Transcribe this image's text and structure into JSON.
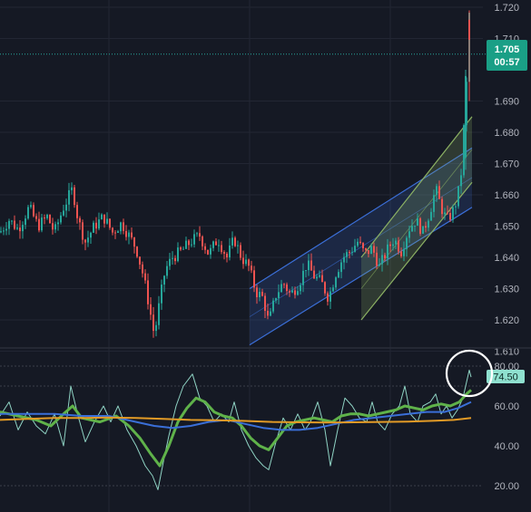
{
  "colors": {
    "background": "#151924",
    "grid": "#222633",
    "axis_text": "#b2b5be",
    "up_candle": "#26a69a",
    "down_candle": "#ef5350",
    "price_badge": "#1a9f86",
    "price_line": "#26a69a",
    "channel_blue": "#3b6fd8",
    "channel_blue_fill": "rgba(59,111,216,0.18)",
    "channel_green": "#8bb063",
    "channel_green_fill": "rgba(139,176,99,0.22)",
    "osc_fast": "#8fd3c4",
    "osc_green": "#5fb24a",
    "osc_blue": "#3a6fd8",
    "osc_orange": "#e39b26",
    "rsi_badge": "#8fe0cf",
    "highlight_circle": "#ffffff"
  },
  "price_axis": {
    "ticks": [
      "1.720",
      "1.710",
      "1.690",
      "1.680",
      "1.670",
      "1.660",
      "1.650",
      "1.640",
      "1.630",
      "1.620",
      "1.610"
    ]
  },
  "price_badge": {
    "price": "1.705",
    "countdown": "00:57"
  },
  "osc_axis": {
    "ticks": [
      "80.00",
      "60.00",
      "40.00",
      "20.00"
    ]
  },
  "osc_badge": {
    "value": "74.50"
  },
  "chart_data": [
    {
      "type": "candlestick",
      "title": "",
      "xlabel": "",
      "ylabel": "",
      "ylim": [
        1.605,
        1.722
      ],
      "last_price": 1.705,
      "price_path": [
        [
          0,
          1.648
        ],
        [
          10,
          1.652
        ],
        [
          20,
          1.649
        ],
        [
          32,
          1.656
        ],
        [
          42,
          1.65
        ],
        [
          52,
          1.653
        ],
        [
          60,
          1.648
        ],
        [
          70,
          1.656
        ],
        [
          80,
          1.662
        ],
        [
          86,
          1.652
        ],
        [
          94,
          1.645
        ],
        [
          104,
          1.65
        ],
        [
          114,
          1.653
        ],
        [
          124,
          1.648
        ],
        [
          134,
          1.651
        ],
        [
          142,
          1.647
        ],
        [
          150,
          1.643
        ],
        [
          158,
          1.634
        ],
        [
          164,
          1.625
        ],
        [
          170,
          1.615
        ],
        [
          176,
          1.626
        ],
        [
          182,
          1.636
        ],
        [
          190,
          1.64
        ],
        [
          200,
          1.642
        ],
        [
          210,
          1.645
        ],
        [
          220,
          1.647
        ],
        [
          230,
          1.641
        ],
        [
          240,
          1.646
        ],
        [
          250,
          1.64
        ],
        [
          258,
          1.646
        ],
        [
          266,
          1.64
        ],
        [
          274,
          1.637
        ],
        [
          282,
          1.629
        ],
        [
          290,
          1.627
        ],
        [
          296,
          1.619
        ],
        [
          304,
          1.628
        ],
        [
          312,
          1.632
        ],
        [
          320,
          1.628
        ],
        [
          330,
          1.632
        ],
        [
          338,
          1.638
        ],
        [
          346,
          1.634
        ],
        [
          354,
          1.632
        ],
        [
          362,
          1.627
        ],
        [
          370,
          1.635
        ],
        [
          378,
          1.64
        ],
        [
          386,
          1.642
        ],
        [
          394,
          1.645
        ],
        [
          402,
          1.641
        ],
        [
          410,
          1.643
        ],
        [
          418,
          1.637
        ],
        [
          426,
          1.642
        ],
        [
          434,
          1.646
        ],
        [
          442,
          1.642
        ],
        [
          450,
          1.649
        ],
        [
          458,
          1.652
        ],
        [
          466,
          1.648
        ],
        [
          474,
          1.655
        ],
        [
          480,
          1.662
        ],
        [
          486,
          1.656
        ],
        [
          492,
          1.652
        ],
        [
          498,
          1.654
        ],
        [
          504,
          1.659
        ],
        [
          508,
          1.667
        ],
        [
          512,
          1.686
        ],
        [
          515,
          1.7
        ],
        [
          517,
          1.718
        ],
        [
          519,
          1.706
        ]
      ],
      "channels": [
        {
          "name": "",
          "color": "#3b6fd8",
          "upper": [
            [
              275,
              1.63
            ],
            [
              520,
              1.675
            ]
          ],
          "lower": [
            [
              275,
              1.612
            ],
            [
              520,
              1.656
            ]
          ]
        },
        {
          "name": "",
          "color": "#8bb063",
          "upper": [
            [
              398,
              1.64
            ],
            [
              520,
              1.685
            ]
          ],
          "lower": [
            [
              398,
              1.62
            ],
            [
              520,
              1.664
            ]
          ]
        }
      ]
    },
    {
      "type": "line",
      "title": "",
      "ylim": [
        15,
        90
      ],
      "levels": [
        80,
        70,
        20
      ],
      "last_value": 74.5,
      "series": [
        {
          "color": "#8fd3c4",
          "points": [
            [
              0,
              55
            ],
            [
              10,
              62
            ],
            [
              20,
              48
            ],
            [
              30,
              57
            ],
            [
              40,
              50
            ],
            [
              50,
              46
            ],
            [
              60,
              56
            ],
            [
              70,
              40
            ],
            [
              78,
              70
            ],
            [
              86,
              55
            ],
            [
              94,
              42
            ],
            [
              104,
              52
            ],
            [
              114,
              60
            ],
            [
              122,
              52
            ],
            [
              130,
              60
            ],
            [
              140,
              48
            ],
            [
              150,
              40
            ],
            [
              160,
              30
            ],
            [
              168,
              25
            ],
            [
              174,
              18
            ],
            [
              180,
              32
            ],
            [
              186,
              45
            ],
            [
              194,
              60
            ],
            [
              202,
              70
            ],
            [
              212,
              76
            ],
            [
              220,
              64
            ],
            [
              228,
              60
            ],
            [
              236,
              52
            ],
            [
              244,
              56
            ],
            [
              252,
              52
            ],
            [
              258,
              62
            ],
            [
              266,
              48
            ],
            [
              274,
              40
            ],
            [
              282,
              34
            ],
            [
              290,
              30
            ],
            [
              296,
              28
            ],
            [
              304,
              42
            ],
            [
              312,
              54
            ],
            [
              320,
              48
            ],
            [
              328,
              56
            ],
            [
              336,
              48
            ],
            [
              342,
              52
            ],
            [
              350,
              62
            ],
            [
              358,
              48
            ],
            [
              364,
              30
            ],
            [
              372,
              48
            ],
            [
              380,
              64
            ],
            [
              388,
              60
            ],
            [
              396,
              54
            ],
            [
              404,
              52
            ],
            [
              410,
              62
            ],
            [
              416,
              52
            ],
            [
              424,
              48
            ],
            [
              432,
              56
            ],
            [
              440,
              60
            ],
            [
              446,
              70
            ],
            [
              452,
              56
            ],
            [
              460,
              52
            ],
            [
              466,
              60
            ],
            [
              474,
              62
            ],
            [
              480,
              66
            ],
            [
              486,
              56
            ],
            [
              492,
              60
            ],
            [
              498,
              54
            ],
            [
              504,
              58
            ],
            [
              510,
              64
            ],
            [
              514,
              72
            ],
            [
              517,
              78
            ],
            [
              519,
              74.5
            ]
          ]
        },
        {
          "color": "#5fb24a",
          "points": [
            [
              0,
              57
            ],
            [
              20,
              55
            ],
            [
              40,
              53
            ],
            [
              56,
              50
            ],
            [
              70,
              56
            ],
            [
              80,
              60
            ],
            [
              90,
              54
            ],
            [
              110,
              52
            ],
            [
              128,
              55
            ],
            [
              142,
              50
            ],
            [
              154,
              44
            ],
            [
              166,
              36
            ],
            [
              176,
              30
            ],
            [
              186,
              40
            ],
            [
              196,
              52
            ],
            [
              206,
              59
            ],
            [
              216,
              64
            ],
            [
              226,
              62
            ],
            [
              236,
              57
            ],
            [
              246,
              55
            ],
            [
              256,
              54
            ],
            [
              266,
              50
            ],
            [
              276,
              44
            ],
            [
              286,
              40
            ],
            [
              296,
              38
            ],
            [
              306,
              44
            ],
            [
              316,
              50
            ],
            [
              326,
              52
            ],
            [
              336,
              53
            ],
            [
              346,
              54
            ],
            [
              356,
              53
            ],
            [
              366,
              52
            ],
            [
              376,
              55
            ],
            [
              386,
              56
            ],
            [
              396,
              56
            ],
            [
              406,
              55
            ],
            [
              416,
              56
            ],
            [
              426,
              57
            ],
            [
              436,
              58
            ],
            [
              446,
              60
            ],
            [
              456,
              59
            ],
            [
              466,
              58
            ],
            [
              476,
              60
            ],
            [
              486,
              61
            ],
            [
              496,
              60
            ],
            [
              506,
              62
            ],
            [
              514,
              66
            ],
            [
              519,
              68
            ]
          ]
        },
        {
          "color": "#3a6fd8",
          "points": [
            [
              0,
              56
            ],
            [
              30,
              56
            ],
            [
              60,
              56
            ],
            [
              90,
              55
            ],
            [
              120,
              55
            ],
            [
              150,
              52
            ],
            [
              170,
              50
            ],
            [
              190,
              49
            ],
            [
              210,
              50
            ],
            [
              230,
              52
            ],
            [
              250,
              53
            ],
            [
              270,
              51
            ],
            [
              290,
              49
            ],
            [
              310,
              48
            ],
            [
              330,
              48
            ],
            [
              350,
              49
            ],
            [
              370,
              51
            ],
            [
              390,
              53
            ],
            [
              410,
              54
            ],
            [
              430,
              55
            ],
            [
              450,
              56
            ],
            [
              470,
              57
            ],
            [
              490,
              57
            ],
            [
              505,
              59
            ],
            [
              519,
              62
            ]
          ]
        },
        {
          "color": "#e39b26",
          "points": [
            [
              0,
              53
            ],
            [
              30,
              53.5
            ],
            [
              60,
              54
            ],
            [
              90,
              54
            ],
            [
              120,
              54.2
            ],
            [
              150,
              54
            ],
            [
              180,
              53.5
            ],
            [
              210,
              53
            ],
            [
              240,
              52.8
            ],
            [
              270,
              52.5
            ],
            [
              300,
              52
            ],
            [
              330,
              51.8
            ],
            [
              360,
              51.7
            ],
            [
              390,
              51.8
            ],
            [
              420,
              52
            ],
            [
              450,
              52.2
            ],
            [
              480,
              52.6
            ],
            [
              500,
              53
            ],
            [
              519,
              54
            ]
          ]
        }
      ]
    }
  ]
}
